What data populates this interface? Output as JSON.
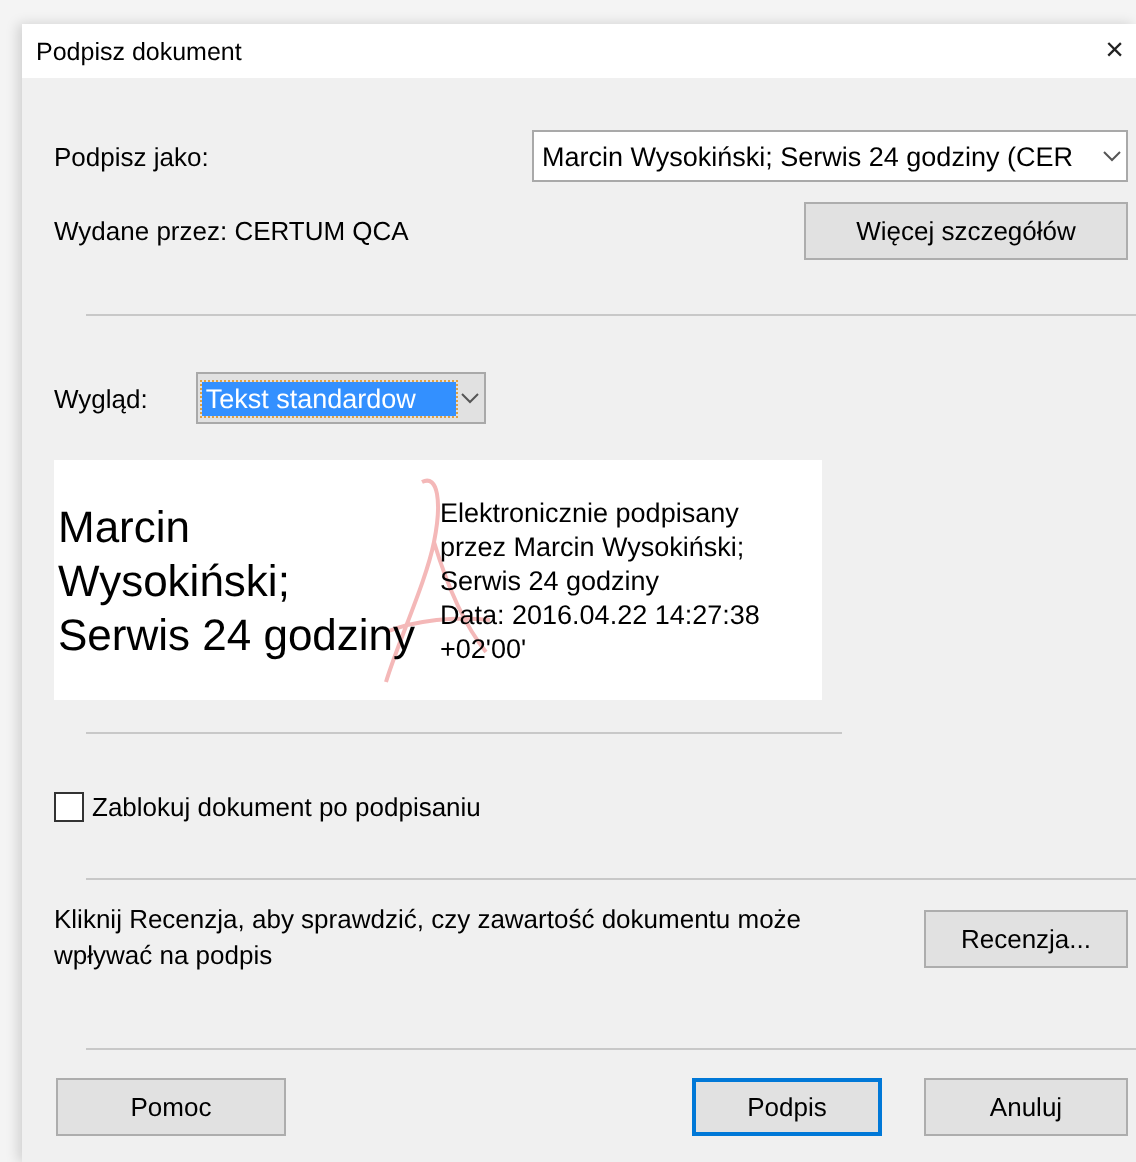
{
  "window": {
    "title": "Podpisz dokument",
    "close": "×"
  },
  "sign_as": {
    "label": "Podpisz jako:",
    "value": "Marcin Wysokiński; Serwis 24 godziny (CER"
  },
  "issuer": {
    "label": "Wydane przez: CERTUM QCA",
    "button": "Więcej szczegółów"
  },
  "appearance": {
    "label": "Wygląd:",
    "value": "Tekst standardow",
    "selected_text": true
  },
  "preview": {
    "name_lines": [
      "Marcin",
      "Wysokiński;",
      "Serwis 24 godziny"
    ],
    "detail_lines": [
      "Elektronicznie podpisany",
      "przez Marcin Wysokiński;",
      "Serwis 24 godziny",
      "Data: 2016.04.22 14:27:38",
      "+02'00'"
    ]
  },
  "lock": {
    "label": "Zablokuj dokument po podpisaniu",
    "checked": false
  },
  "review": {
    "text": "Kliknij Recenzja, aby sprawdzić, czy zawartość dokumentu może wpływać na podpis",
    "button": "Recenzja..."
  },
  "buttons": [
    {
      "label": "Pomoc",
      "default": false
    },
    {
      "label": "Podpis",
      "default": true
    },
    {
      "label": "Anuluj",
      "default": false
    }
  ]
}
